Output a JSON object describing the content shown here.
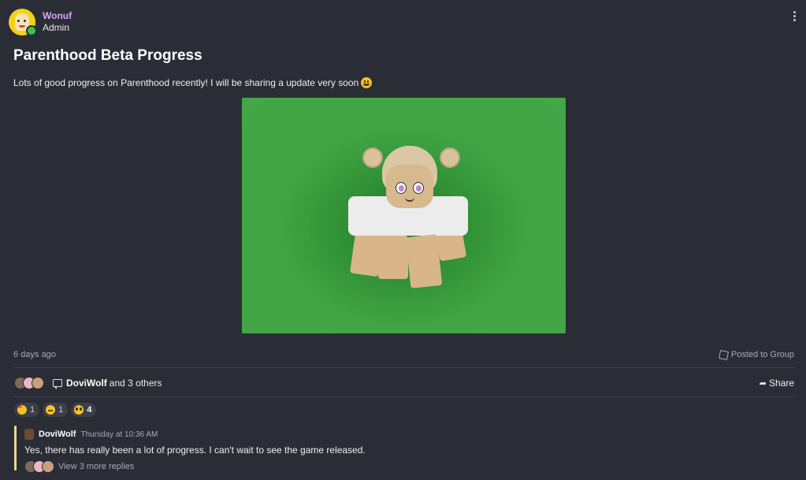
{
  "post": {
    "author": "Wonuf",
    "role": "Admin",
    "title": "Parenthood Beta Progress",
    "body": "Lots of good progress on Parenthood recently! I will be sharing a update very soon",
    "timestamp": "6 days ago",
    "posted_to": "Posted to Group",
    "image_description": "roblox-avatar-green-background"
  },
  "engagement": {
    "top_name": "DoviWolf",
    "rest": "and 3 others",
    "share_label": "Share"
  },
  "reactions": [
    {
      "icon": "heart-eyes-emoji",
      "count": "1"
    },
    {
      "icon": "sleepy-emoji",
      "count": "1"
    },
    {
      "icon": "pleading-emoji",
      "count": "4"
    }
  ],
  "comment": {
    "author": "DoviWolf",
    "time": "Thursday at 10:36 AM",
    "text": "Yes, there has really been a lot of progress. I can't wait to see the game released.",
    "replies_label": "View 3 more replies"
  },
  "colors": {
    "background": "#2b2d36",
    "author_name": "#d7a6ff",
    "image_green": "#44a746",
    "comment_bar": "#e9d88e",
    "online": "#3ec24a"
  }
}
